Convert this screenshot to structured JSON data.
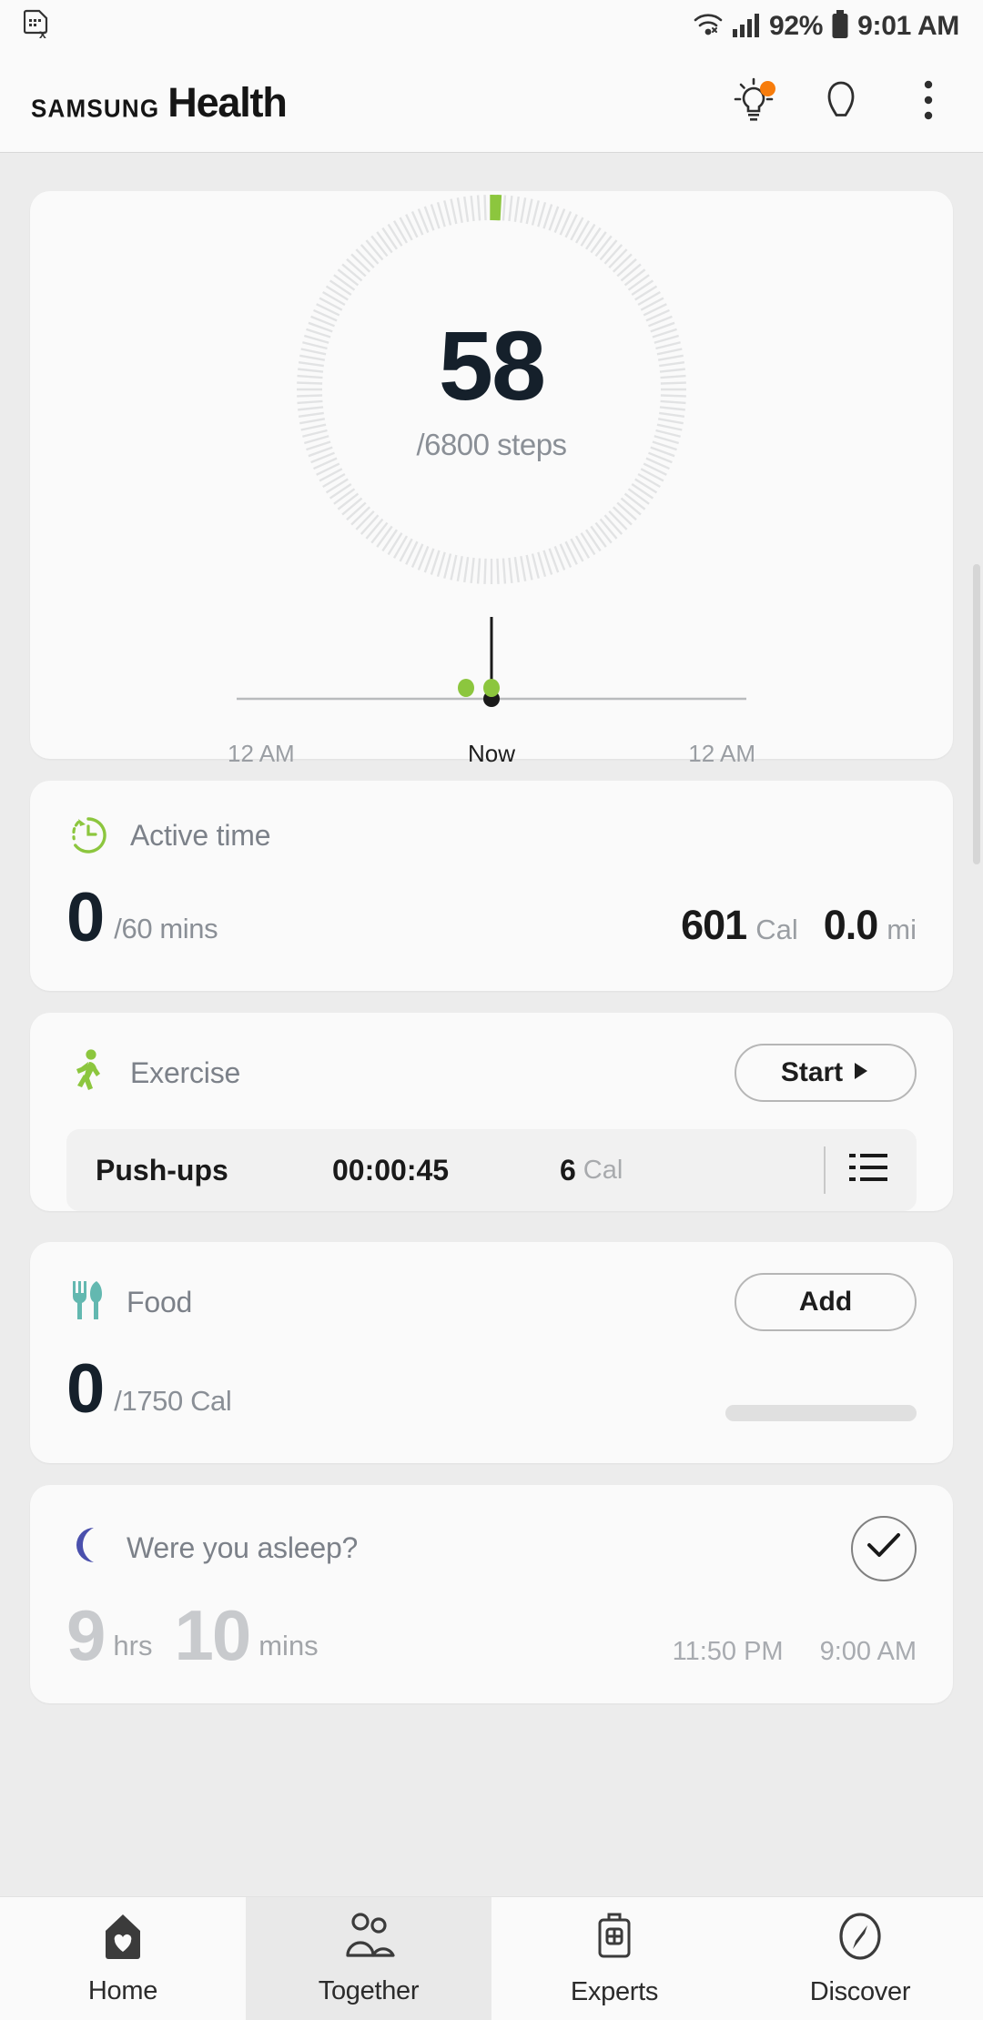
{
  "statusbar": {
    "sim_icon": "sim-card-error-icon",
    "wifi_icon": "wifi-icon",
    "signal_icon": "cellular-signal-icon",
    "battery_percent": "92%",
    "battery_icon": "battery-icon",
    "time": "9:01 AM"
  },
  "appbar": {
    "brand_samsung": "SAMSUNG",
    "brand_health": "Health",
    "tips_icon": "lightbulb-icon",
    "profile_icon": "profile-icon",
    "more_icon": "more-options-icon",
    "badge_color": "#f77c0b"
  },
  "steps": {
    "value": "58",
    "goal_label": "/6800 steps",
    "goal": 6800,
    "progress_percent": 0.85,
    "accent_color": "#8cc63e",
    "timeline": {
      "left_label": "12 AM",
      "now_label": "Now",
      "right_label": "12 AM"
    }
  },
  "active_time": {
    "title": "Active time",
    "icon": "stopwatch-icon",
    "icon_color": "#8cc63e",
    "value": "0",
    "unit": "/60 mins",
    "calories_value": "601",
    "calories_unit": "Cal",
    "distance_value": "0.0",
    "distance_unit": "mi"
  },
  "exercise": {
    "title": "Exercise",
    "icon": "running-person-icon",
    "icon_color": "#8cc63e",
    "start_label": "Start",
    "start_icon": "play-icon",
    "entry": {
      "name": "Push-ups",
      "duration": "00:00:45",
      "calories": "6",
      "calories_unit": "Cal",
      "list_icon": "list-icon"
    }
  },
  "food": {
    "title": "Food",
    "icon": "fork-knife-icon",
    "icon_color": "#63b8b0",
    "add_label": "Add",
    "value": "0",
    "unit": "/1750 Cal",
    "progress_percent": 0
  },
  "sleep": {
    "title": "Were you asleep?",
    "icon": "moon-icon",
    "icon_color": "#4a50ad",
    "confirm_icon": "check-icon",
    "hours": "9",
    "hours_unit": "hrs",
    "minutes": "10",
    "minutes_unit": "mins",
    "start_time": "11:50 PM",
    "end_time": "9:00 AM",
    "bar_color": "#c5c7ef"
  },
  "bottomnav": {
    "items": [
      {
        "label": "Home",
        "icon": "home-heart-icon",
        "selected": false
      },
      {
        "label": "Together",
        "icon": "people-icon",
        "selected": true
      },
      {
        "label": "Experts",
        "icon": "medical-bag-icon",
        "selected": false
      },
      {
        "label": "Discover",
        "icon": "compass-icon",
        "selected": false
      }
    ]
  }
}
